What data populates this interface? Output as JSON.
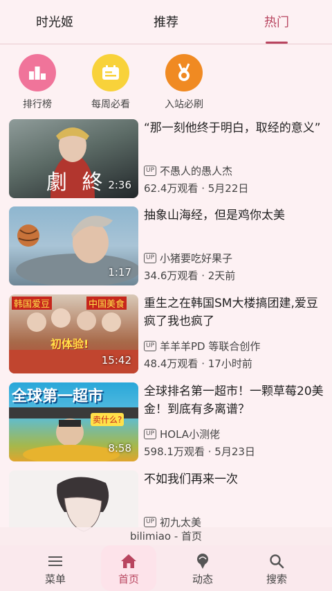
{
  "tabs": [
    {
      "label": "时光姬"
    },
    {
      "label": "推荐"
    },
    {
      "label": "热门",
      "active": true
    }
  ],
  "quick_links": [
    {
      "label": "排行榜",
      "icon": "ranking-icon",
      "color": "#f0749a"
    },
    {
      "label": "每周必看",
      "icon": "weekly-calendar-icon",
      "color": "#f8d23a"
    },
    {
      "label": "入站必刷",
      "icon": "medal-icon",
      "color": "#f08a22"
    }
  ],
  "videos": [
    {
      "title": "“那一刻他终于明白，取经的意义”",
      "uploader": "不愚人的愚人杰",
      "views": "62.4万观看",
      "time": "5月22日",
      "duration": "2:36",
      "thumb_text": "劇 終"
    },
    {
      "title": "抽象山海经，但是鸡你太美",
      "uploader": "小猪要吃好果子",
      "views": "34.6万观看",
      "time": "2天前",
      "duration": "1:17"
    },
    {
      "title": "重生之在韩国SM大楼搞团建,爱豆疯了我也疯了",
      "uploader": "羊羊羊PD 等联合创作",
      "views": "48.4万观看",
      "time": "17小时前",
      "duration": "15:42",
      "thumb_tag1": "韩国爱豆",
      "thumb_tag2": "中国美食",
      "thumb_tag3": "初体验!"
    },
    {
      "title": "全球排名第一超市！一颗草莓20美金！到底有多离谱？",
      "uploader": "HOLA小测佬",
      "views": "598.1万观看",
      "time": "5月23日",
      "duration": "8:58",
      "thumb_text": "全球第一超市",
      "thumb_sub": "卖什么?"
    },
    {
      "title": "不如我们再来一次",
      "uploader": "初九太美"
    }
  ],
  "up_badge": "UP",
  "separator": "·",
  "caption": "bilimiao - 首页",
  "nav": [
    {
      "label": "菜单",
      "icon": "menu-icon"
    },
    {
      "label": "首页",
      "icon": "home-icon",
      "active": true
    },
    {
      "label": "动态",
      "icon": "dynamic-icon"
    },
    {
      "label": "搜索",
      "icon": "search-icon"
    }
  ],
  "colors": {
    "accent": "#b8455f",
    "background": "#fdf1f3"
  }
}
